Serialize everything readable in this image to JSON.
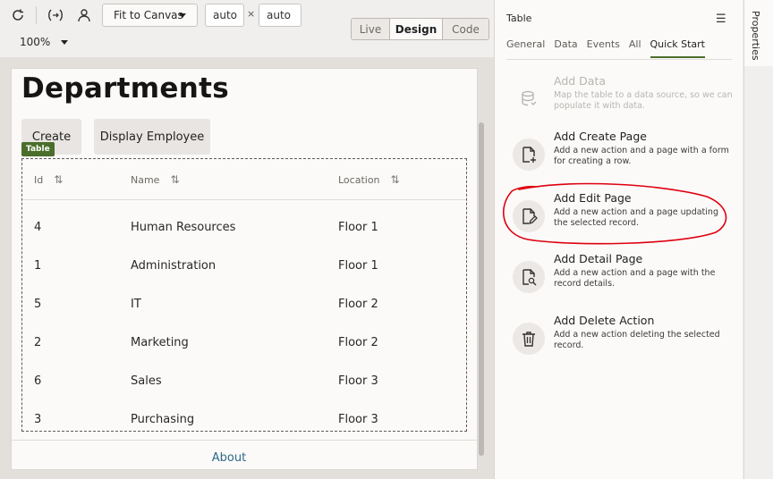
{
  "toolbar": {
    "fit_label": "Fit to Canvas",
    "width_value": "auto",
    "height_value": "auto",
    "times": "×",
    "zoom": "100%",
    "modes": [
      "Live",
      "Design",
      "Code"
    ]
  },
  "page": {
    "title": "Departments",
    "buttons": [
      "Create",
      "Display Employee"
    ],
    "table_tag": "Table",
    "columns": [
      "Id",
      "Name",
      "Location"
    ],
    "sort_glyph": "⇅",
    "rows": [
      [
        "4",
        "Human Resources",
        "Floor 1"
      ],
      [
        "1",
        "Administration",
        "Floor 1"
      ],
      [
        "5",
        "IT",
        "Floor 2"
      ],
      [
        "2",
        "Marketing",
        "Floor 2"
      ],
      [
        "6",
        "Sales",
        "Floor 3"
      ],
      [
        "3",
        "Purchasing",
        "Floor 3"
      ]
    ],
    "footer_link": "About"
  },
  "panel": {
    "title": "Table",
    "menu_glyph": "☰",
    "tabs": [
      "General",
      "Data",
      "Events",
      "All",
      "Quick Start"
    ],
    "quick_start": [
      {
        "title": "Add Data",
        "desc": "Map the table to a data source, so we can populate it with data."
      },
      {
        "title": "Add Create Page",
        "desc": "Add a new action and a page with a form for creating a row."
      },
      {
        "title": "Add Edit Page",
        "desc": "Add a new action and a page updating the selected record."
      },
      {
        "title": "Add Detail Page",
        "desc": "Add a new action and a page with the record details."
      },
      {
        "title": "Add Delete Action",
        "desc": "Add a new action deleting the selected record."
      }
    ],
    "vertical_tab": "Properties"
  },
  "colors": {
    "accent_green": "#4b6e2b",
    "link_blue": "#2e6a87",
    "annotation_red": "#e0000f"
  }
}
